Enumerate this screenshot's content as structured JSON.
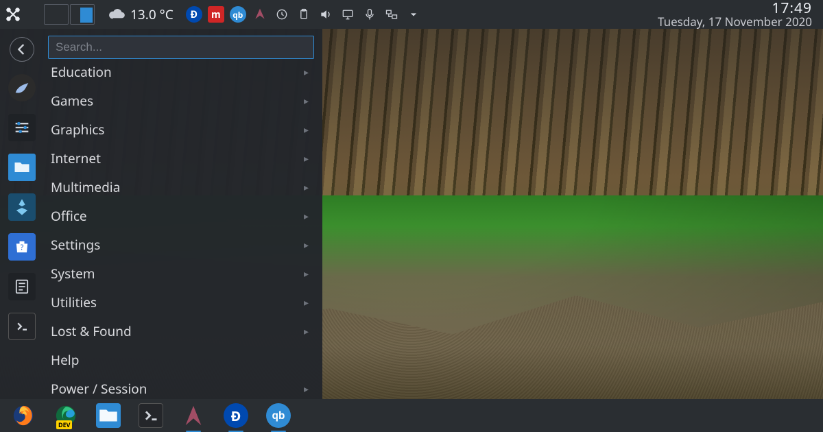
{
  "top_panel": {
    "temperature": "13.0 °C",
    "clock_time": "17:49",
    "clock_date": "Tuesday, 17 November 2020",
    "tray_icons": [
      {
        "name": "digibyte-icon",
        "glyph": "D"
      },
      {
        "name": "multipass-icon",
        "glyph": "M"
      },
      {
        "name": "qbittorrent-icon",
        "glyph": "qb"
      },
      {
        "name": "ravencoin-icon"
      },
      {
        "name": "updates-icon"
      },
      {
        "name": "clipboard-icon"
      },
      {
        "name": "volume-icon"
      },
      {
        "name": "display-icon"
      },
      {
        "name": "microphone-icon"
      },
      {
        "name": "network-icon"
      },
      {
        "name": "expand-icon"
      }
    ]
  },
  "menu": {
    "search_placeholder": "Search...",
    "categories": [
      {
        "label": "Education",
        "has_sub": true
      },
      {
        "label": "Games",
        "has_sub": true
      },
      {
        "label": "Graphics",
        "has_sub": true
      },
      {
        "label": "Internet",
        "has_sub": true
      },
      {
        "label": "Multimedia",
        "has_sub": true
      },
      {
        "label": "Office",
        "has_sub": true
      },
      {
        "label": "Settings",
        "has_sub": true
      },
      {
        "label": "System",
        "has_sub": true
      },
      {
        "label": "Utilities",
        "has_sub": true
      },
      {
        "label": "Lost & Found",
        "has_sub": true
      },
      {
        "label": "Help",
        "has_sub": false
      },
      {
        "label": "Power / Session",
        "has_sub": true
      }
    ],
    "sidebar": [
      {
        "name": "back-button"
      },
      {
        "name": "falkon-browser"
      },
      {
        "name": "system-settings"
      },
      {
        "name": "file-manager"
      },
      {
        "name": "kdenlive"
      },
      {
        "name": "discover-store"
      },
      {
        "name": "kate-editor"
      },
      {
        "name": "konsole-terminal"
      }
    ]
  },
  "dock": {
    "apps": [
      {
        "name": "firefox",
        "running": false
      },
      {
        "name": "edge-dev",
        "running": false,
        "badge": "DEV"
      },
      {
        "name": "file-manager",
        "running": false
      },
      {
        "name": "konsole-terminal",
        "running": false
      },
      {
        "name": "ravencoin",
        "running": true
      },
      {
        "name": "digibyte",
        "running": true,
        "glyph": "D"
      },
      {
        "name": "qbittorrent",
        "running": true,
        "glyph": "qb"
      }
    ]
  }
}
